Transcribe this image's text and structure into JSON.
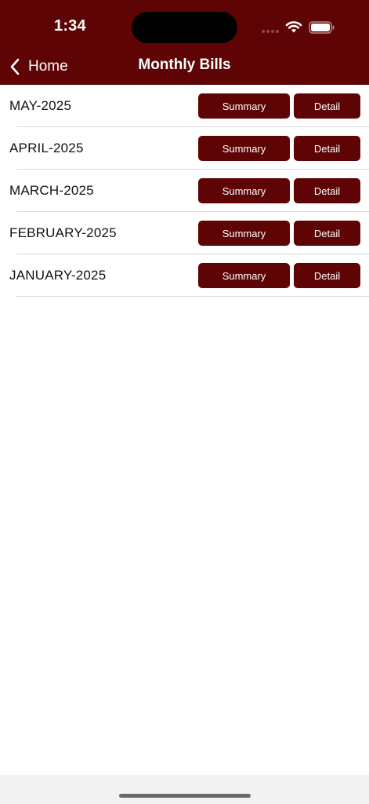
{
  "status_bar": {
    "time": "1:34"
  },
  "nav": {
    "back_label": "Home",
    "title": "Monthly Bills"
  },
  "bills": [
    {
      "month": "MAY-2025",
      "summary_label": "Summary",
      "detail_label": "Detail"
    },
    {
      "month": "APRIL-2025",
      "summary_label": "Summary",
      "detail_label": "Detail"
    },
    {
      "month": "MARCH-2025",
      "summary_label": "Summary",
      "detail_label": "Detail"
    },
    {
      "month": "FEBRUARY-2025",
      "summary_label": "Summary",
      "detail_label": "Detail"
    },
    {
      "month": "JANUARY-2025",
      "summary_label": "Summary",
      "detail_label": "Detail"
    }
  ],
  "colors": {
    "brand": "#5e0405",
    "background": "#ffffff",
    "separator": "#dcdcdc"
  },
  "icons": [
    "back-chevron-icon",
    "wifi-icon",
    "battery-icon",
    "signal-icon"
  ]
}
